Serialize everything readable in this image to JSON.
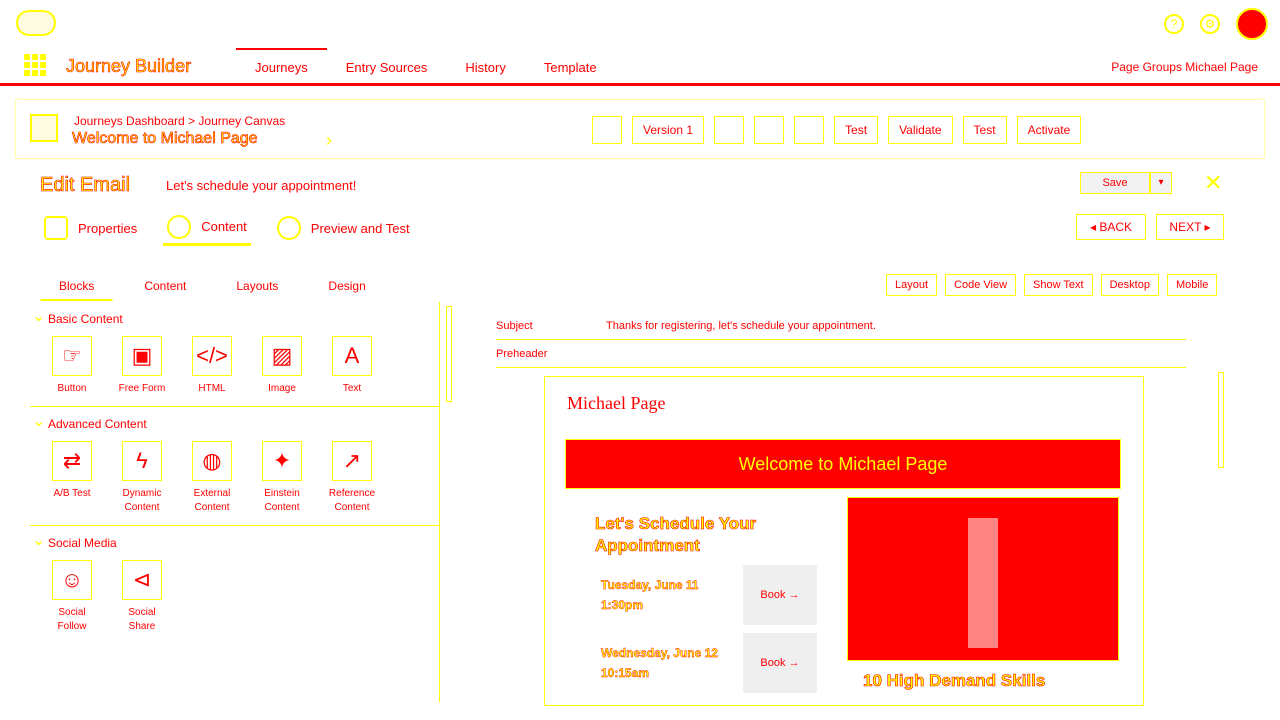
{
  "header": {
    "icons": {
      "help": "?",
      "settings": "⚙"
    }
  },
  "appbar": {
    "app_name": "Journey Builder",
    "tabs": [
      "Journeys",
      "Entry Sources",
      "History",
      "Template"
    ],
    "user": "Page Groups Michael Page"
  },
  "journey": {
    "breadcrumb": "Journeys Dashboard > Journey Canvas",
    "title": "Welcome to Michael Page",
    "tools": [
      "Version 1",
      "Test",
      "Validate",
      "Test",
      "Activate"
    ]
  },
  "edit_email": {
    "title": "Edit Email",
    "subtitle": "Let's schedule your appointment!",
    "save_label": "Save",
    "close_icon": "✕",
    "wizard_tabs": [
      "Properties",
      "Content",
      "Preview and Test"
    ],
    "back_label": "◂ BACK",
    "next_label": "NEXT ▸",
    "content_tabs": [
      "Blocks",
      "Content",
      "Layouts",
      "Design"
    ],
    "view_options": [
      "Layout",
      "Code View",
      "Show Text",
      "Desktop",
      "Mobile"
    ]
  },
  "blocks": {
    "basic": {
      "title": "Basic Content",
      "items": [
        {
          "label": "Button",
          "icon": "☞"
        },
        {
          "label": "Free Form",
          "icon": "▣"
        },
        {
          "label": "HTML",
          "icon": "</>"
        },
        {
          "label": "Image",
          "icon": "▨"
        },
        {
          "label": "Text",
          "icon": "A"
        }
      ]
    },
    "advanced": {
      "title": "Advanced Content",
      "items": [
        {
          "label": "A/B Test",
          "icon": "⇄"
        },
        {
          "label": "Dynamic Content",
          "icon": "ϟ"
        },
        {
          "label": "External Content",
          "icon": "◍"
        },
        {
          "label": "Einstein Content",
          "icon": "✦"
        },
        {
          "label": "Reference Content",
          "icon": "↗"
        }
      ]
    },
    "social": {
      "title": "Social Media",
      "items": [
        {
          "label": "Social Follow",
          "icon": "☺"
        },
        {
          "label": "Social Share",
          "icon": "⊲"
        }
      ]
    }
  },
  "email": {
    "subject_label": "Subject",
    "subject_value": "Thanks for registering, let's schedule your appointment.",
    "preheader_label": "Preheader",
    "preheader_value": "",
    "brand": "Michael Page",
    "banner": "Welcome to Michael Page",
    "schedule_title": "Let's Schedule Your Appointment",
    "slots": [
      {
        "when": "Tuesday, June 11\n1:30pm",
        "book": "Book →"
      },
      {
        "when": "Wednesday, June 12\n10:15am",
        "book": "Book →"
      }
    ],
    "article_title": "10 High Demand Skills"
  }
}
